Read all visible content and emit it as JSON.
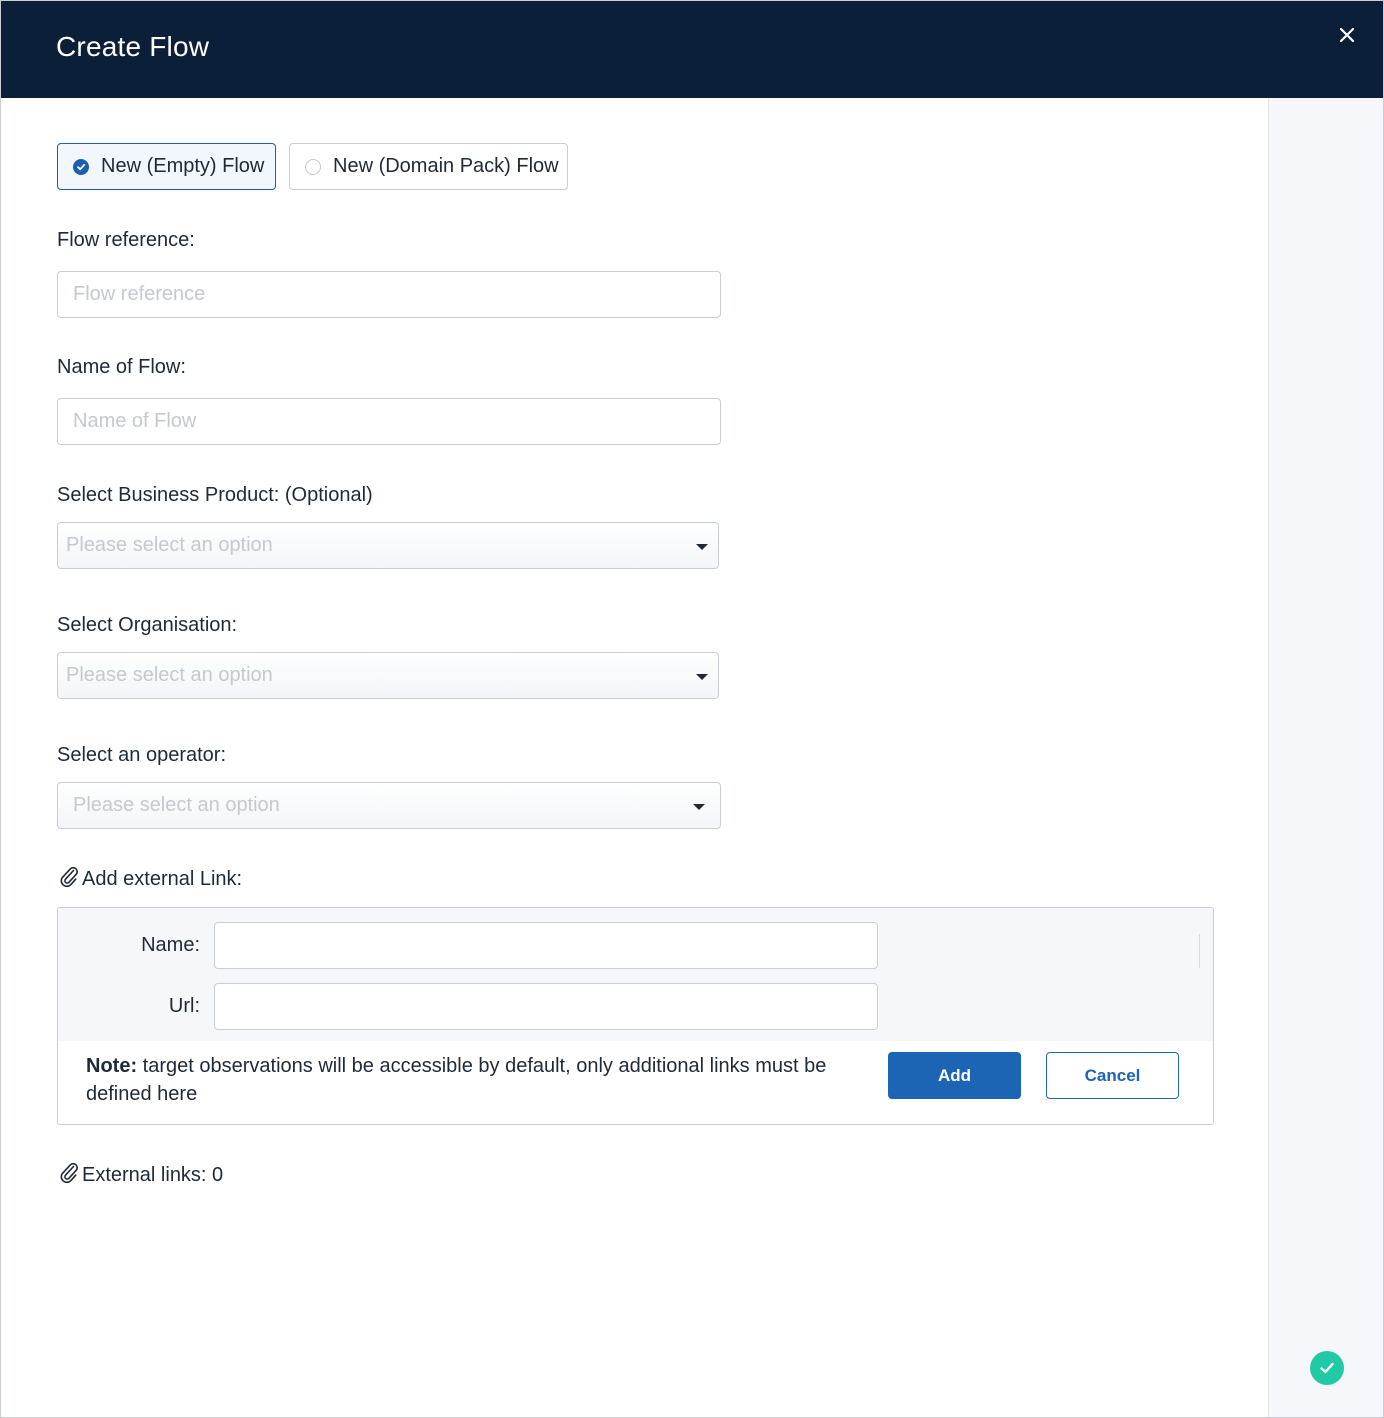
{
  "header": {
    "title": "Create Flow",
    "close_icon": "close-icon"
  },
  "flow_type": {
    "options": [
      {
        "label": "New (Empty) Flow",
        "selected": true
      },
      {
        "label": "New (Domain Pack) Flow",
        "selected": false
      }
    ]
  },
  "form": {
    "flow_reference": {
      "label": "Flow reference:",
      "placeholder": "Flow reference",
      "value": ""
    },
    "flow_name": {
      "label": "Name of Flow:",
      "placeholder": "Name of Flow",
      "value": ""
    },
    "business_product": {
      "label": "Select Business Product: (Optional)",
      "placeholder": "Please select an option"
    },
    "organisation": {
      "label": "Select Organisation:",
      "placeholder": "Please select an option"
    },
    "operator": {
      "label": "Select an operator:",
      "placeholder": "Please select an option"
    }
  },
  "external_link": {
    "heading": "Add external Link:",
    "name_label": "Name:",
    "url_label": "Url:",
    "name_value": "",
    "url_value": "",
    "note_bold": "Note:",
    "note_text": " target observations will be accessible by default, only additional links must be defined here",
    "add_label": "Add",
    "cancel_label": "Cancel"
  },
  "external_links_count": {
    "label": "External links: 0"
  },
  "colors": {
    "header_bg": "#0b1f38",
    "primary": "#1c64b4",
    "success": "#21c9a6"
  }
}
